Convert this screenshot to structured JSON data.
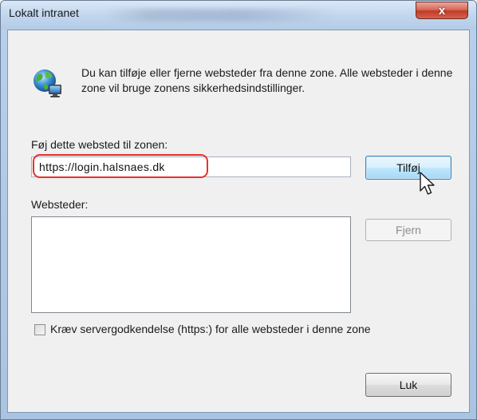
{
  "window": {
    "title": "Lokalt intranet",
    "close_glyph": "x",
    "accent_close": "#c94a34",
    "accent_highlight": "#e8302a"
  },
  "description": "Du kan tilføje eller fjerne websteder fra denne zone. Alle websteder i denne zone vil bruge zonens sikkerhedsindstillinger.",
  "icons": {
    "zone": "globe-monitor-icon",
    "cursor": "mouse-pointer-icon"
  },
  "add_site": {
    "label": "Føj dette websted til zonen:",
    "value": "https://login.halsnaes.dk",
    "button": "Tilføj"
  },
  "sites": {
    "label": "Websteder:",
    "items": [],
    "remove_button": "Fjern"
  },
  "require_https": {
    "label": "Kræv servergodkendelse (https:) for alle websteder i denne zone",
    "checked": false
  },
  "footer": {
    "close_button": "Luk"
  }
}
